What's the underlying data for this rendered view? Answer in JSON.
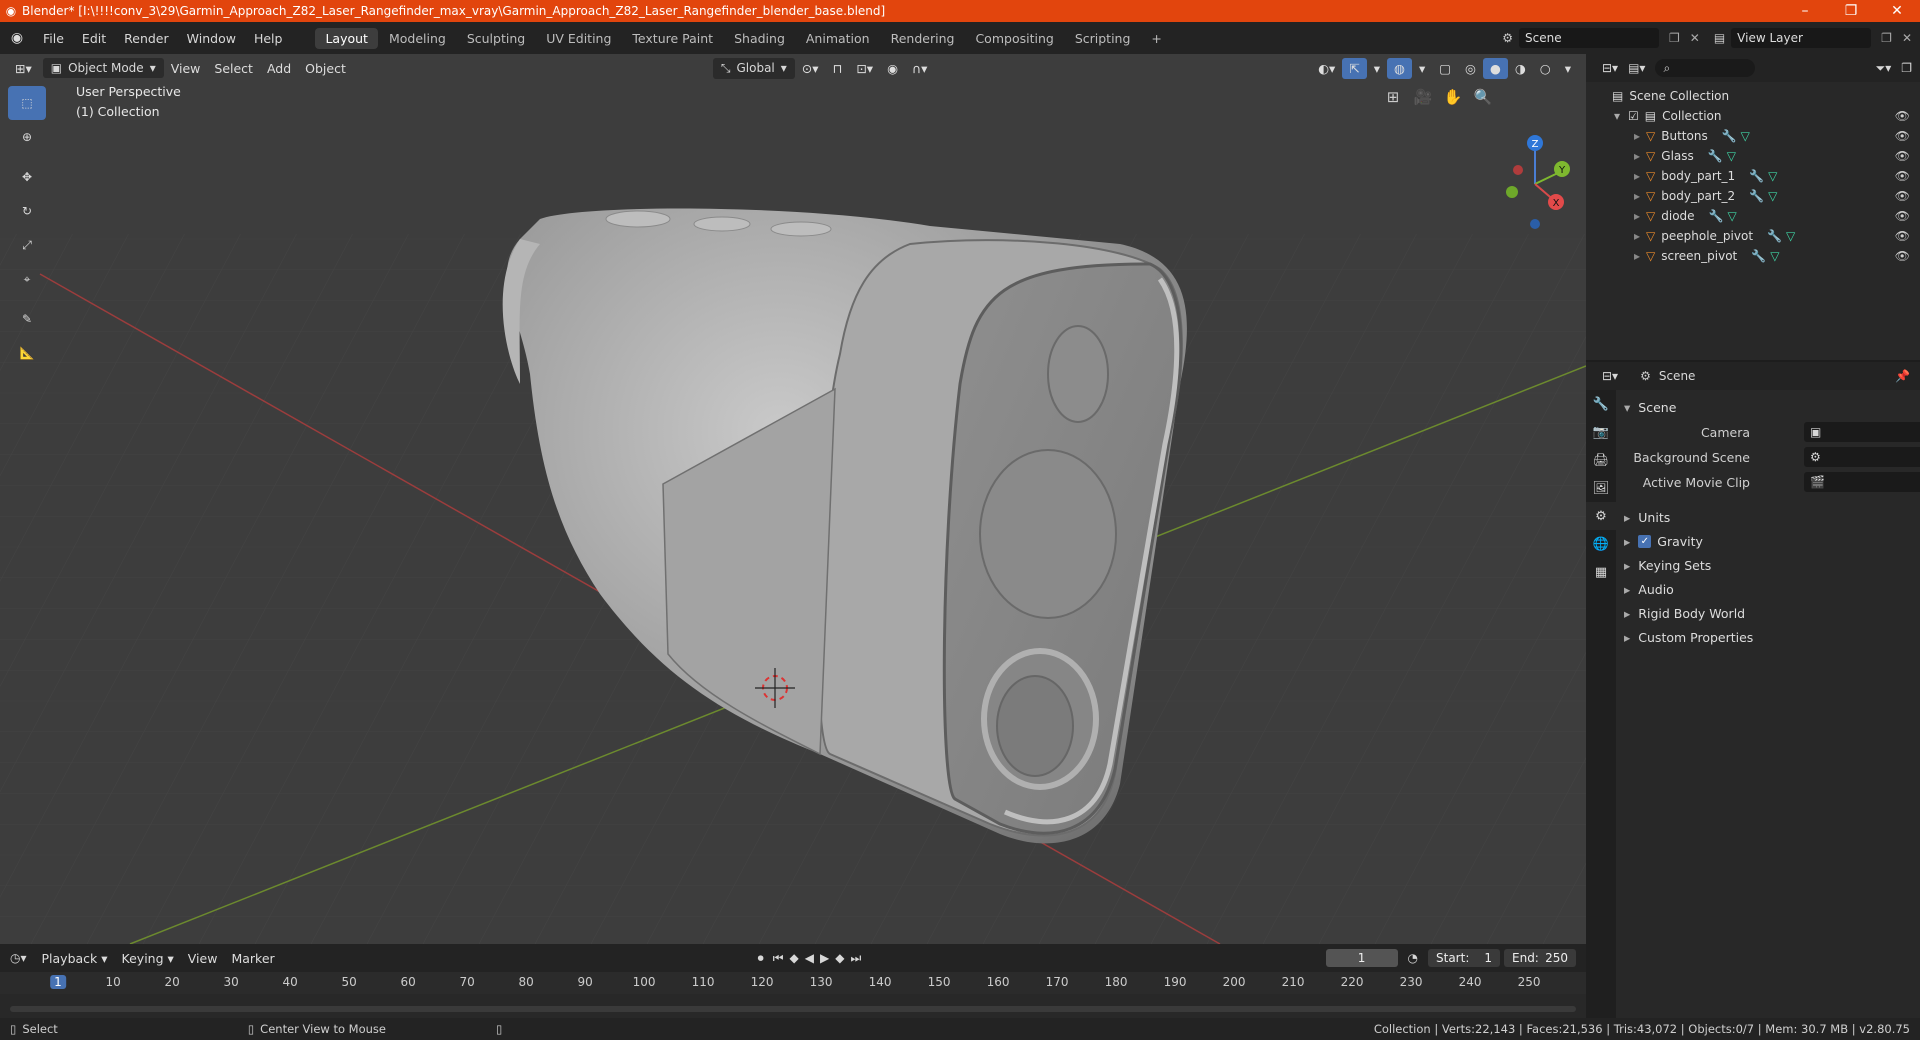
{
  "window": {
    "title": "Blender* [I:\\!!!!conv_3\\29\\Garmin_Approach_Z82_Laser_Rangefinder_max_vray\\Garmin_Approach_Z82_Laser_Rangefinder_blender_base.blend]",
    "minimize": "–",
    "maximize": "❐",
    "close": "✕"
  },
  "menu": [
    "File",
    "Edit",
    "Render",
    "Window",
    "Help"
  ],
  "workspaces": [
    "Layout",
    "Modeling",
    "Sculpting",
    "UV Editing",
    "Texture Paint",
    "Shading",
    "Animation",
    "Rendering",
    "Compositing",
    "Scripting"
  ],
  "active_workspace": "Layout",
  "scene_name": "Scene",
  "view_layer": "View Layer",
  "viewport": {
    "mode": "Object Mode",
    "menus": [
      "View",
      "Select",
      "Add",
      "Object"
    ],
    "orientation": "Global",
    "perspective_label": "User Perspective",
    "collection_label": "(1) Collection",
    "gizmo_axes": [
      "Z",
      "Y",
      "X"
    ]
  },
  "outliner": {
    "root": "Scene Collection",
    "collection": "Collection",
    "objects": [
      "Buttons",
      "Glass",
      "body_part_1",
      "body_part_2",
      "diode",
      "peephole_pivot",
      "screen_pivot"
    ]
  },
  "properties": {
    "header_title": "Scene",
    "panel_title": "Scene",
    "fields": [
      {
        "label": "Camera",
        "value": ""
      },
      {
        "label": "Background Scene",
        "value": ""
      },
      {
        "label": "Active Movie Clip",
        "value": ""
      }
    ],
    "sections": [
      "Units",
      "Gravity",
      "Keying Sets",
      "Audio",
      "Rigid Body World",
      "Custom Properties"
    ],
    "gravity_checked": true
  },
  "timeline": {
    "menus": [
      "Playback",
      "Keying",
      "View",
      "Marker"
    ],
    "current_frame": "1",
    "start_label": "Start:",
    "start": "1",
    "end_label": "End:",
    "end": "250",
    "ticks": [
      "1",
      "10",
      "20",
      "30",
      "40",
      "50",
      "60",
      "70",
      "80",
      "90",
      "100",
      "110",
      "120",
      "130",
      "140",
      "150",
      "160",
      "170",
      "180",
      "190",
      "200",
      "210",
      "220",
      "230",
      "240",
      "250"
    ]
  },
  "status": {
    "left_action": "Select",
    "middle_action": "Center View to Mouse",
    "stats": "Collection | Verts:22,143 | Faces:21,536 | Tris:43,072 | Objects:0/7 | Mem: 30.7 MB | v2.80.75"
  },
  "colors": {
    "accent": "#4772b3",
    "titlebar": "#e2450d",
    "object_icon": "#e8892b",
    "mesh_icon": "#3fd3a4"
  }
}
